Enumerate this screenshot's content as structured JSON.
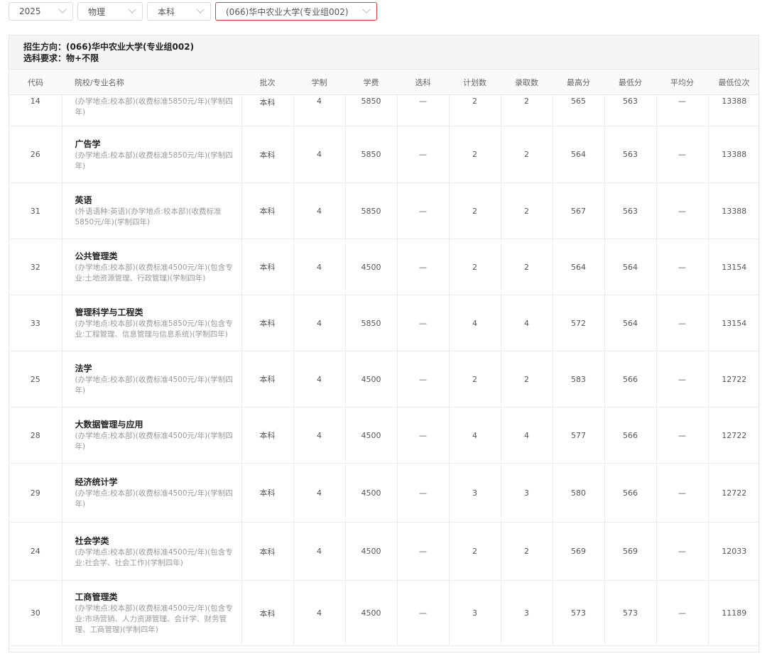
{
  "filters": [
    {
      "value": "2025",
      "active": false
    },
    {
      "value": "物理",
      "active": false
    },
    {
      "value": "本科",
      "active": false
    },
    {
      "value": "(066)华中农业大学(专业组002)",
      "active": true
    }
  ],
  "info": {
    "direction_label": "招生方向：",
    "direction_value": "(066)华中农业大学(专业组002)",
    "subject_label": "选科要求：",
    "subject_value": "物+不限"
  },
  "table": {
    "headers": [
      "代码",
      "院校/专业名称",
      "批次",
      "学制",
      "学费",
      "选科",
      "计划数",
      "录取数",
      "最高分",
      "最低分",
      "平均分",
      "最低位次"
    ],
    "rows": [
      {
        "code": "14",
        "name": "",
        "desc": "(办学地点:校本部)(收费标准5850元/年)(学制四年)",
        "batch": "本科",
        "years": "4",
        "fee": "5850",
        "subject": "—",
        "plan": "2",
        "admit": "2",
        "max": "565",
        "min": "563",
        "avg": "—",
        "rank": "13388"
      },
      {
        "code": "26",
        "name": "广告学",
        "desc": "(办学地点:校本部)(收费标准5850元/年)(学制四年)",
        "batch": "本科",
        "years": "4",
        "fee": "5850",
        "subject": "—",
        "plan": "2",
        "admit": "2",
        "max": "564",
        "min": "563",
        "avg": "—",
        "rank": "13388"
      },
      {
        "code": "31",
        "name": "英语",
        "desc": "(外语语种:英语)(办学地点:校本部)(收费标准5850元/年)(学制四年)",
        "batch": "本科",
        "years": "4",
        "fee": "5850",
        "subject": "—",
        "plan": "2",
        "admit": "2",
        "max": "567",
        "min": "563",
        "avg": "—",
        "rank": "13388"
      },
      {
        "code": "32",
        "name": "公共管理类",
        "desc": "(办学地点:校本部)(收费标准4500元/年)(包含专业:土地资源管理、行政管理)(学制四年)",
        "batch": "本科",
        "years": "4",
        "fee": "4500",
        "subject": "—",
        "plan": "2",
        "admit": "2",
        "max": "564",
        "min": "564",
        "avg": "—",
        "rank": "13154"
      },
      {
        "code": "33",
        "name": "管理科学与工程类",
        "desc": "(办学地点:校本部)(收费标准5850元/年)(包含专业:工程管理、信息管理与信息系统)(学制四年)",
        "batch": "本科",
        "years": "4",
        "fee": "5850",
        "subject": "—",
        "plan": "4",
        "admit": "4",
        "max": "572",
        "min": "564",
        "avg": "—",
        "rank": "13154"
      },
      {
        "code": "25",
        "name": "法学",
        "desc": "(办学地点:校本部)(收费标准4500元/年)(学制四年)",
        "batch": "本科",
        "years": "4",
        "fee": "4500",
        "subject": "—",
        "plan": "2",
        "admit": "2",
        "max": "583",
        "min": "566",
        "avg": "—",
        "rank": "12722"
      },
      {
        "code": "28",
        "name": "大数据管理与应用",
        "desc": "(办学地点:校本部)(收费标准4500元/年)(学制四年)",
        "batch": "本科",
        "years": "4",
        "fee": "4500",
        "subject": "—",
        "plan": "4",
        "admit": "4",
        "max": "577",
        "min": "566",
        "avg": "—",
        "rank": "12722"
      },
      {
        "code": "29",
        "name": "经济统计学",
        "desc": "(办学地点:校本部)(收费标准4500元/年)(学制四年)",
        "batch": "本科",
        "years": "4",
        "fee": "4500",
        "subject": "—",
        "plan": "3",
        "admit": "3",
        "max": "580",
        "min": "566",
        "avg": "—",
        "rank": "12722"
      },
      {
        "code": "24",
        "name": "社会学类",
        "desc": "(办学地点:校本部)(收费标准4500元/年)(包含专业:社会学、社会工作)(学制四年)",
        "batch": "本科",
        "years": "4",
        "fee": "4500",
        "subject": "—",
        "plan": "2",
        "admit": "2",
        "max": "569",
        "min": "569",
        "avg": "—",
        "rank": "12033"
      },
      {
        "code": "30",
        "name": "工商管理类",
        "desc": "(办学地点:校本部)(收费标准4500元/年)(包含专业:市场营销、人力资源管理、会计学、财务管理、工商管理)(学制四年)",
        "batch": "本科",
        "years": "4",
        "fee": "4500",
        "subject": "—",
        "plan": "3",
        "admit": "3",
        "max": "573",
        "min": "573",
        "avg": "—",
        "rank": "11189"
      }
    ]
  }
}
